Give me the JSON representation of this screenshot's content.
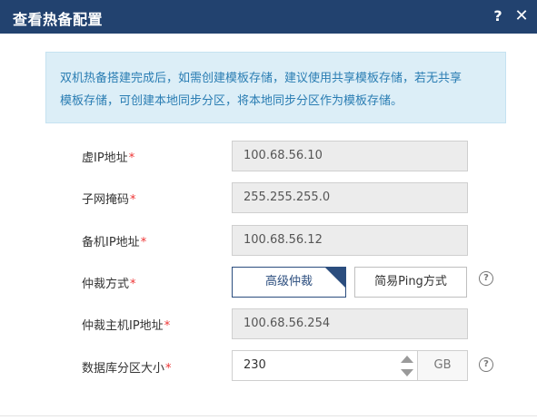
{
  "dialog": {
    "title": "查看热备配置",
    "help_icon": "?",
    "close_icon": "✕"
  },
  "info": {
    "line1": "双机热备搭建完成后，如需创建模板存储，建议使用共享模板存储，若无共享",
    "line2": "模板存储，可创建本地同步分区，将本地同步分区作为模板存储。"
  },
  "form": {
    "virtual_ip": {
      "label": "虚IP地址",
      "value": "100.68.56.10"
    },
    "subnet_mask": {
      "label": "子网掩码",
      "value": "255.255.255.0"
    },
    "backup_ip": {
      "label": "备机IP地址",
      "value": "100.68.56.12"
    },
    "arbitration": {
      "label": "仲裁方式",
      "options": [
        "高级仲裁",
        "简易Ping方式"
      ],
      "selected": "高级仲裁"
    },
    "arbiter_ip": {
      "label": "仲裁主机IP地址",
      "value": "100.68.56.254"
    },
    "db_partition": {
      "label": "数据库分区大小",
      "value": "230",
      "unit": "GB"
    },
    "required_mark": "*",
    "help_mark": "?"
  },
  "colors": {
    "header_bg": "#22426f",
    "info_bg": "#dceef7",
    "info_text": "#2a7db3",
    "required": "#e33333",
    "selected_option": "#2b4d7e"
  }
}
